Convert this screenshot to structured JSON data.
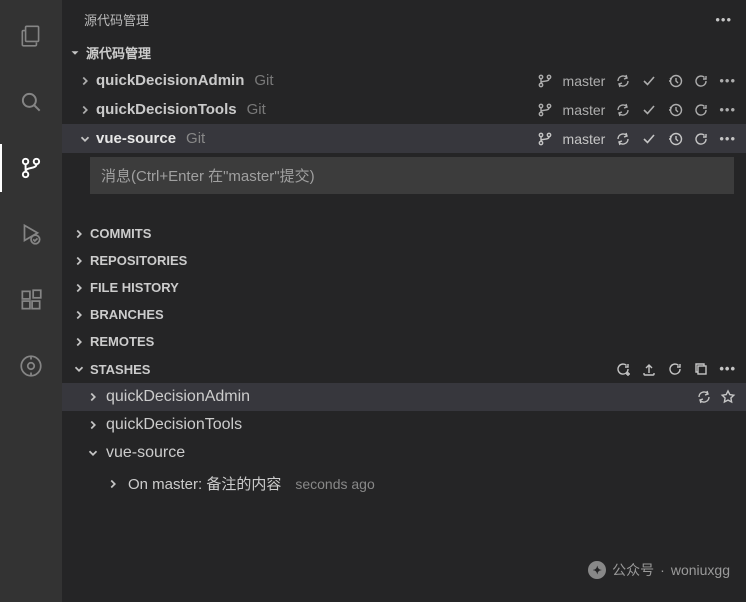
{
  "sidebar_title": "源代码管理",
  "section_scm": "源代码管理",
  "repos": [
    {
      "name": "quickDecisionAdmin",
      "type": "Git",
      "branch": "master",
      "expanded": false,
      "selected": false
    },
    {
      "name": "quickDecisionTools",
      "type": "Git",
      "branch": "master",
      "expanded": false,
      "selected": false
    },
    {
      "name": "vue-source",
      "type": "Git",
      "branch": "master",
      "expanded": true,
      "selected": true
    }
  ],
  "commit_placeholder": "消息(Ctrl+Enter 在\"master\"提交)",
  "sections": {
    "commits": "COMMITS",
    "repositories": "REPOSITORIES",
    "file_history": "FILE HISTORY",
    "branches": "BRANCHES",
    "remotes": "REMOTES",
    "stashes": "STASHES"
  },
  "stashes": [
    {
      "name": "quickDecisionAdmin",
      "expanded": false,
      "selected": true
    },
    {
      "name": "quickDecisionTools",
      "expanded": false,
      "selected": false
    },
    {
      "name": "vue-source",
      "expanded": true,
      "selected": false
    }
  ],
  "stash_entry": {
    "label": "On master: 备注的内容",
    "ago": "seconds ago"
  },
  "watermark": {
    "prefix": "公众号",
    "sep": "·",
    "name": "woniuxgg"
  }
}
